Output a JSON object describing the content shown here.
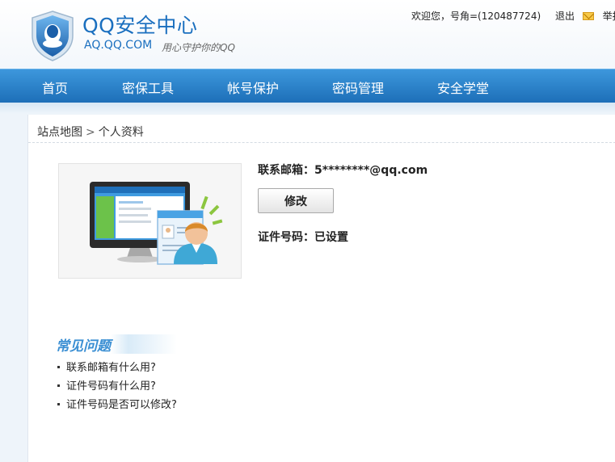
{
  "header": {
    "title": "QQ安全中心",
    "domain": "AQ.QQ.COM",
    "slogan": "用心守护你的QQ",
    "welcome": "欢迎您，号角=(120487724)",
    "logout": "退出",
    "report": "举报"
  },
  "nav": {
    "items": [
      "首页",
      "密保工具",
      "帐号保护",
      "密码管理",
      "安全学堂"
    ]
  },
  "breadcrumb": {
    "root": "站点地图",
    "current": "个人资料"
  },
  "profile": {
    "email_label": "联系邮箱：",
    "email_value": "5********@qq.com",
    "modify_label": "修改",
    "id_label": "证件号码：",
    "id_value": "已设置"
  },
  "faq": {
    "title": "常见问题",
    "items": [
      "联系邮箱有什么用?",
      "证件号码有什么用?",
      "证件号码是否可以修改?"
    ]
  },
  "colors": {
    "brand_blue": "#1a6fbf",
    "nav_top": "#3d97dc",
    "nav_bottom": "#1d6fb8",
    "faq_title": "#3b8fd3"
  }
}
